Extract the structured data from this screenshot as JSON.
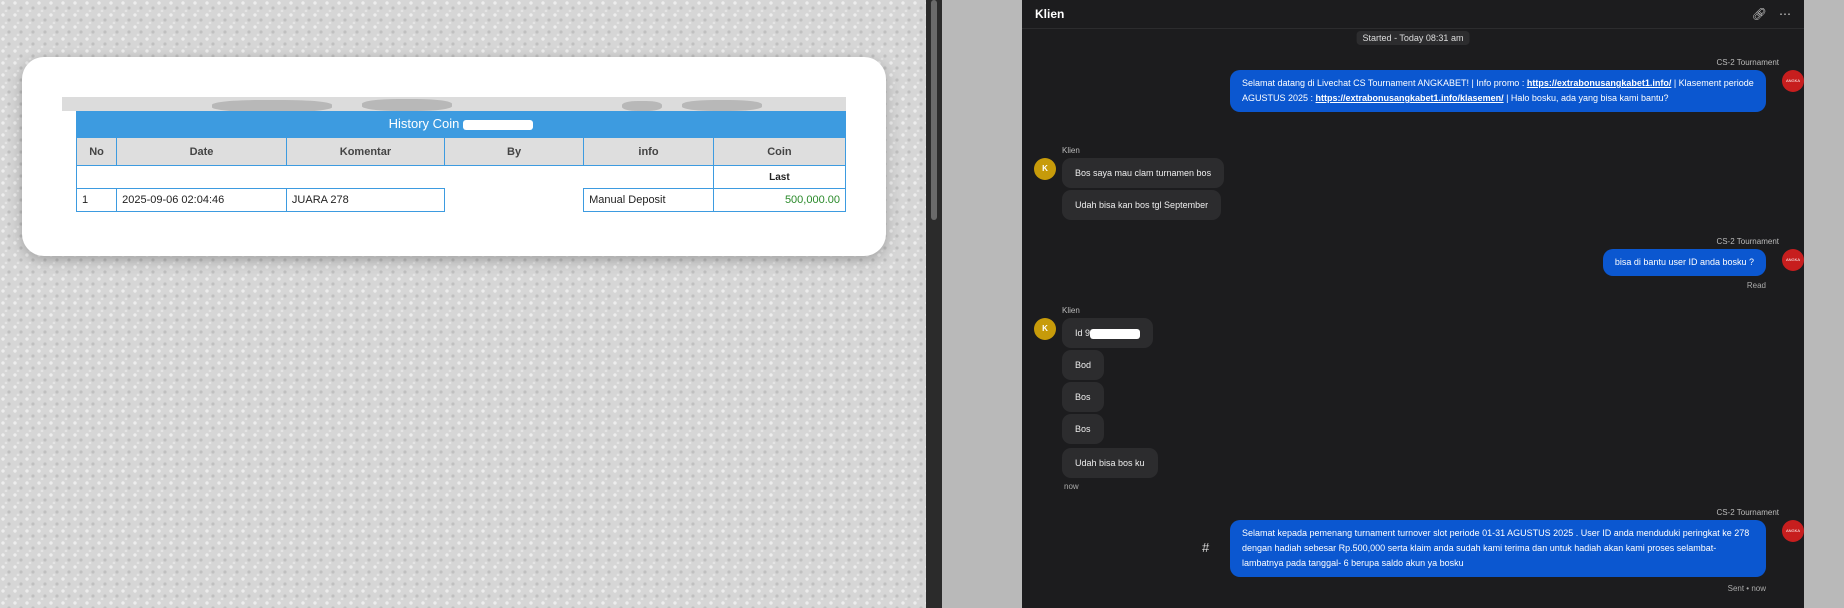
{
  "history_coin": {
    "title": "History Coin",
    "columns": [
      "No",
      "Date",
      "Komentar",
      "By",
      "info",
      "Coin"
    ],
    "last_label": "Last",
    "rows": [
      {
        "no": "1",
        "date": "2025-09-06 02:04:46",
        "komentar": "JUARA 278",
        "by": "",
        "info": "Manual Deposit",
        "coin": "500,000.00"
      }
    ]
  },
  "chat": {
    "header_title": "Klien",
    "header_icons": [
      "link-icon",
      "more-icon"
    ],
    "started": "Started - Today 08:31 am",
    "agent_name": "CS-2 Tournament",
    "client_name": "Klien",
    "client_initial": "K",
    "agent_avatar_text": "ANGKA",
    "msg1": {
      "text_a": "Selamat datang di Livechat CS Tournament ANGKABET! | Info promo : ",
      "link1": "https://extrabonusangkabet1.info/",
      "text_b": " | Klasement periode AGUSTUS 2025 : ",
      "link2": "https://extrabonusangkabet1.info/klasemen/",
      "text_c": " | Halo bosku, ada yang bisa kami bantu?"
    },
    "client_group1": [
      "Bos saya mau clam turnamen bos",
      "Udah bisa kan bos tgl September"
    ],
    "msg2": "bisa di bantu user ID anda bosku ?",
    "msg2_status": "Read",
    "client_group2": [
      "Id 9",
      "Bod",
      "Bos",
      "Bos",
      "Udah bisa bos ku"
    ],
    "client_group2_time": "now",
    "msg3": "Selamat kepada pemenang turnament turnover slot periode 01-31 AGUSTUS 2025 . User ID anda menduduki peringkat ke 278 dengan hadiah sebesar Rp.500,000 serta klaim anda sudah kami terima dan untuk hadiah akan kami proses selambat-lambatnya pada tanggal- 6 berupa saldo akun ya bosku",
    "msg3_status": "Sent • now",
    "hash_symbol": "#"
  },
  "colors": {
    "table_header": "#3d9be0",
    "agent_bubble": "#0b57d0",
    "client_bubble": "#2c2c2e",
    "chat_bg": "#1c1c1e",
    "coin_green": "#2a8a2a"
  }
}
